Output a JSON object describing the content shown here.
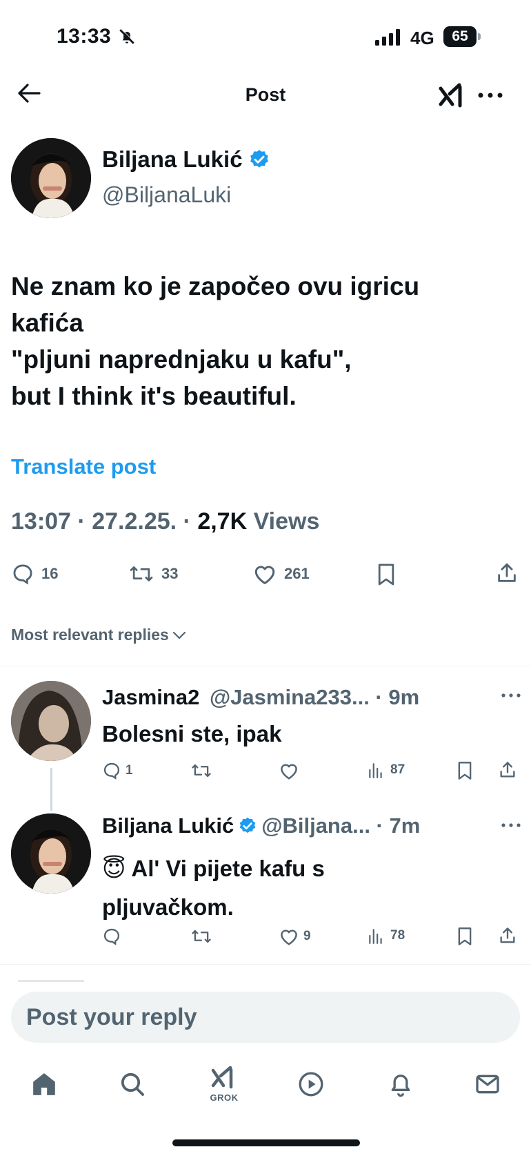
{
  "status_bar": {
    "time": "13:33",
    "network": "4G",
    "battery": "65"
  },
  "header": {
    "title": "Post"
  },
  "post": {
    "author_name": "Biljana Lukić",
    "author_handle": "@BiljanaLuki",
    "text_lines": [
      "Ne znam ko je započeo ovu igricu",
      "kafića",
      "\"pljuni naprednjaku u kafu\",",
      "but I think it's beautiful."
    ],
    "translate": "Translate post",
    "time": "13:07",
    "date": "27.2.25.",
    "views_count": "2,7K",
    "views_label": "Views",
    "replies": "16",
    "reposts": "33",
    "likes": "261"
  },
  "replies_filter": {
    "label": "Most relevant replies"
  },
  "replies": [
    {
      "name": "Jasmina2",
      "handle_time": "@Jasmina233... · 9m",
      "text": "Bolesni ste, ipak",
      "replies": "1",
      "reposts": "",
      "likes": "",
      "views": "87"
    },
    {
      "name": "Biljana Lukić",
      "handle_time": "@Biljana... · 7m",
      "emoji": "😇",
      "text_line1": "Al' Vi pijete kafu s",
      "text_line2": "pljuvačkom.",
      "replies": "",
      "reposts": "",
      "likes": "9",
      "views": "78"
    }
  ],
  "compose": {
    "placeholder": "Post your reply"
  },
  "tabbar": {
    "grok_label": "GROK"
  },
  "colors": {
    "accent": "#1d9bf0",
    "grey": "#536471",
    "verified": "#1d9bf0"
  }
}
